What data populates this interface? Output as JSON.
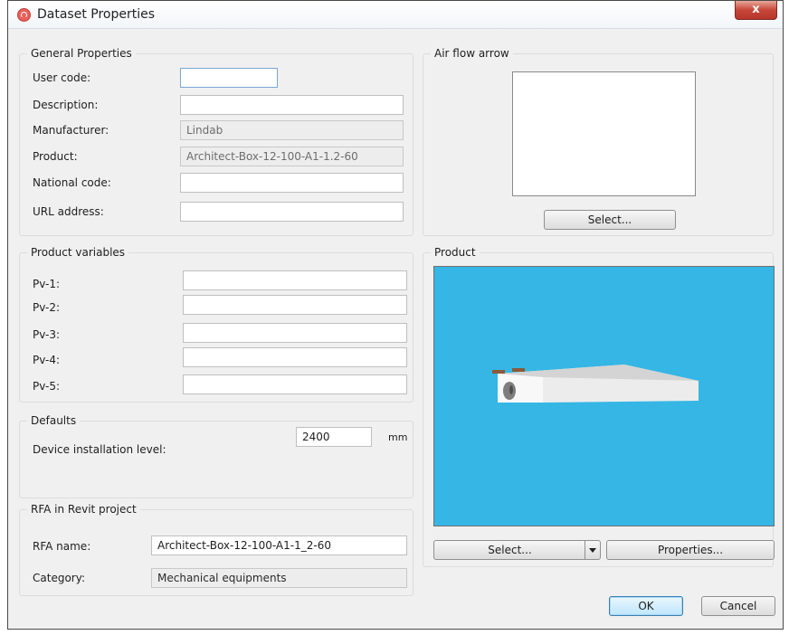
{
  "window": {
    "title": "Dataset Properties",
    "close_glyph": "x"
  },
  "general": {
    "title": "General Properties",
    "fields": [
      {
        "label": "User code:",
        "value": ""
      },
      {
        "label": "Description:",
        "value": ""
      },
      {
        "label": "Manufacturer:",
        "value": "Lindab"
      },
      {
        "label": "Product:",
        "value": "Architect-Box-12-100-A1-1.2-60"
      },
      {
        "label": "National code:",
        "value": ""
      },
      {
        "label": "URL address:",
        "value": ""
      }
    ]
  },
  "airflow": {
    "title": "Air flow arrow",
    "select_label": "Select..."
  },
  "product_vars": {
    "title": "Product variables",
    "fields": [
      {
        "label": "Pv-1:",
        "value": ""
      },
      {
        "label": "Pv-2:",
        "value": ""
      },
      {
        "label": "Pv-3:",
        "value": ""
      },
      {
        "label": "Pv-4:",
        "value": ""
      },
      {
        "label": "Pv-5:",
        "value": ""
      }
    ]
  },
  "defaults": {
    "title": "Defaults",
    "install_label": "Device installation level:",
    "install_value": "2400",
    "unit": "mm"
  },
  "rfa": {
    "title": "RFA in Revit project",
    "name_label": "RFA name:",
    "name_value": "Architect-Box-12-100-A1-1_2-60",
    "category_label": "Category:",
    "category_value": "Mechanical equipments"
  },
  "product": {
    "title": "Product",
    "select_label": "Select...",
    "properties_label": "Properties...",
    "viewport_color": "#35b6e4"
  },
  "footer": {
    "ok_label": "OK",
    "cancel_label": "Cancel"
  }
}
